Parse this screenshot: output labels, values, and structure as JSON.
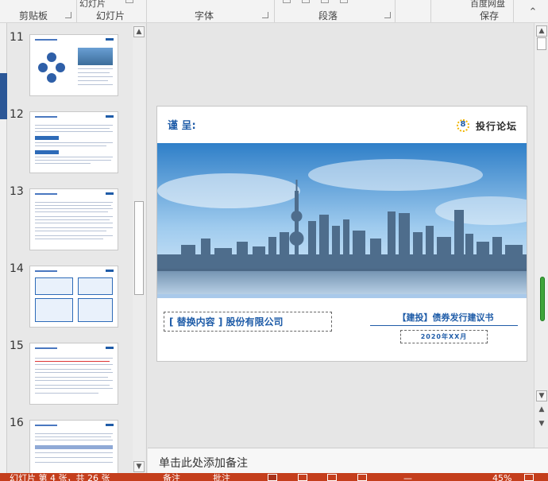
{
  "ribbon": {
    "groups": [
      {
        "label": "剪贴板"
      },
      {
        "label": "幻灯片"
      },
      {
        "label": "字体"
      },
      {
        "label": "段落"
      },
      {
        "label": "保存"
      }
    ],
    "top_fragments": {
      "slides_button": "幻灯片",
      "baidu_button": "百度网盘"
    }
  },
  "thumbnails": [
    {
      "number": "11"
    },
    {
      "number": "12"
    },
    {
      "number": "13"
    },
    {
      "number": "14"
    },
    {
      "number": "15"
    },
    {
      "number": "16"
    }
  ],
  "slide": {
    "greeting": "谨 呈:",
    "brand_logo_number": "8",
    "brand_name": "投行论坛",
    "company_placeholder": "[ 替换内容 ] 股份有限公司",
    "doc_title": "【建投】债券发行建议书",
    "doc_date": "2020年XX月"
  },
  "notes": {
    "placeholder": "单击此处添加备注"
  },
  "status": {
    "slide_info": "幻灯片 第 4 张，共 26 张",
    "notes_label": "备注",
    "comments_label": "批注",
    "zoom": "45%"
  },
  "colors": {
    "accent_blue": "#1f5ca8",
    "status_bar": "#c43e1c",
    "brand_gold": "#f0b400"
  }
}
